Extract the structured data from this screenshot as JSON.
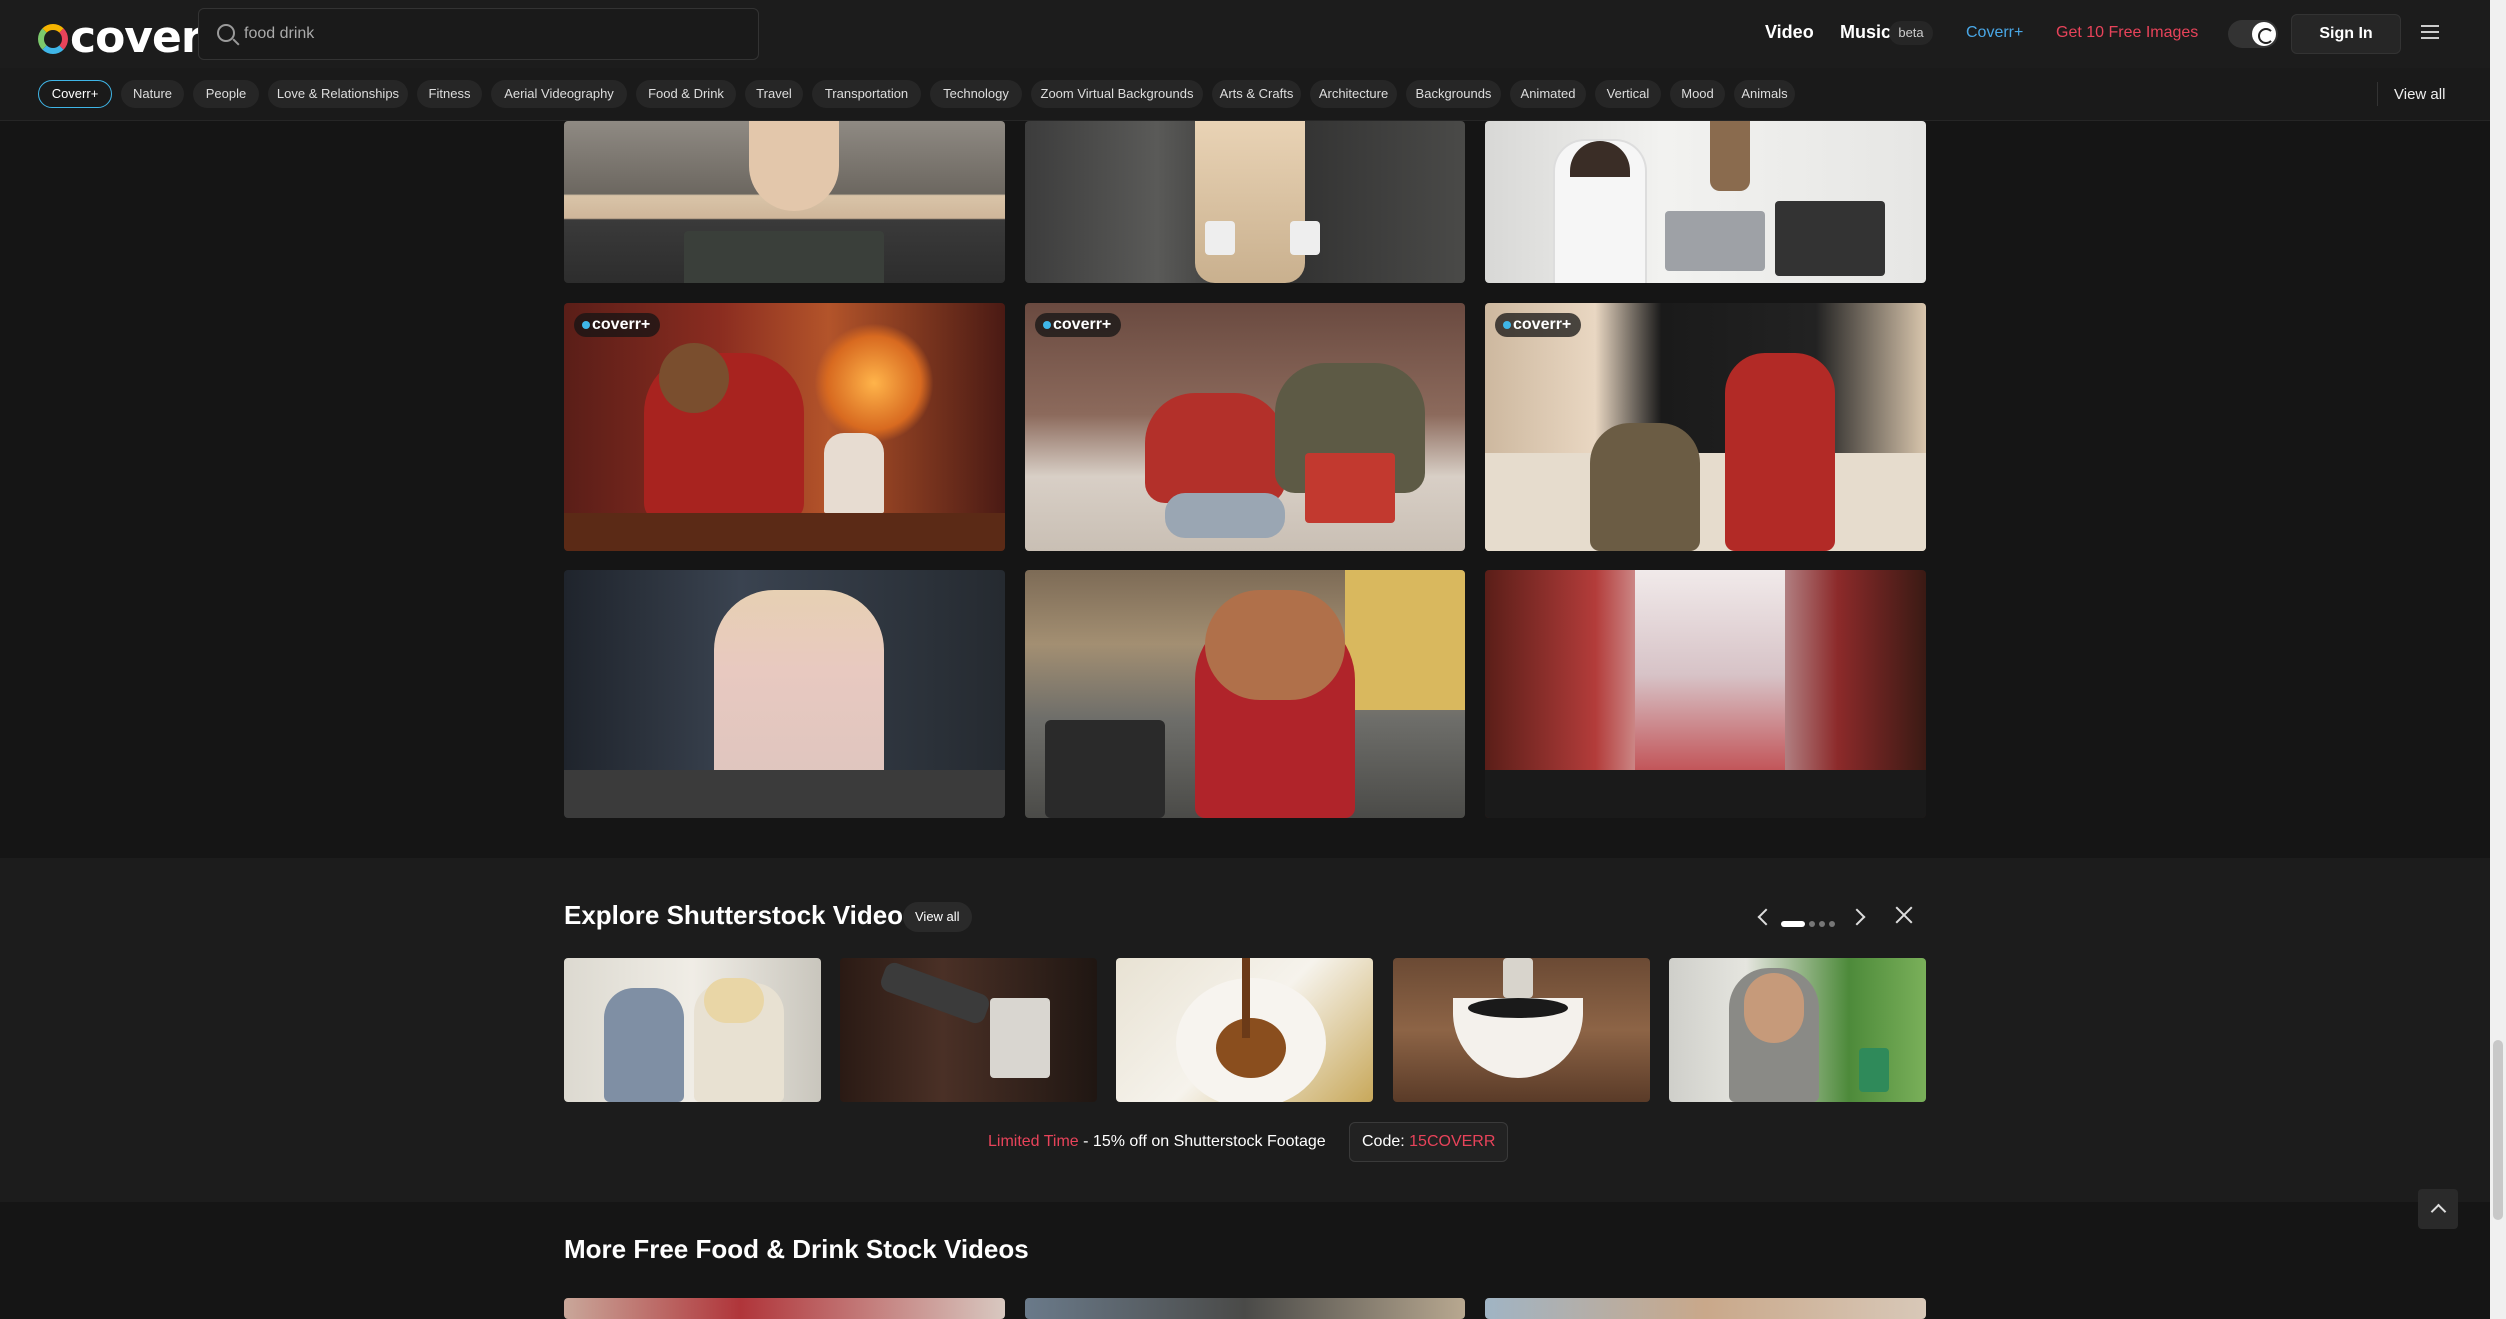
{
  "header": {
    "logo": "coverr",
    "search_value": "food drink",
    "nav_video": "Video",
    "nav_music": "Music",
    "music_badge": "beta",
    "nav_coverr_plus": "Coverr+",
    "nav_free_images": "Get 10 Free Images",
    "sign_in": "Sign In"
  },
  "categories": {
    "items": [
      "Coverr+",
      "Nature",
      "People",
      "Love & Relationships",
      "Fitness",
      "Aerial Videography",
      "Food & Drink",
      "Travel",
      "Transportation",
      "Technology",
      "Zoom Virtual Backgrounds",
      "Arts & Crafts",
      "Architecture",
      "Backgrounds",
      "Animated",
      "Vertical",
      "Mood",
      "Animals"
    ],
    "active": "Coverr+",
    "view_all": "View all"
  },
  "grid": {
    "badge_text": "coverr+",
    "tiles": [
      {
        "scene": "woman at laptop in office"
      },
      {
        "scene": "woman holding mug in office"
      },
      {
        "scene": "man at laptop, woman with mug"
      },
      {
        "scene": "woman writing letter by fireplace",
        "badge": true
      },
      {
        "scene": "couple with gifts on sofa",
        "badge": true
      },
      {
        "scene": "two women in living room",
        "badge": true
      },
      {
        "scene": "woman in pink blazer at table"
      },
      {
        "scene": "woman with phone at outdoor cafe"
      },
      {
        "scene": "hands holding milkshake cup"
      }
    ]
  },
  "shutterstock": {
    "title": "Explore Shutterstock Videos",
    "view_all": "View all",
    "promo_red": "Limited Time",
    "promo_text": " - 15% off on Shutterstock Footage",
    "code_label": "Code: ",
    "code_value": "15COVERR",
    "thumbs": [
      "two women having tea",
      "barista with coffee tamper",
      "espresso pouring into cup",
      "tea powder into bowl",
      "man drinking in car"
    ]
  },
  "more_section": {
    "title": "More Free Food & Drink Stock Videos"
  },
  "colors": {
    "accent_blue": "#3fb6e8",
    "accent_red": "#e8435a",
    "bg": "#151515"
  }
}
